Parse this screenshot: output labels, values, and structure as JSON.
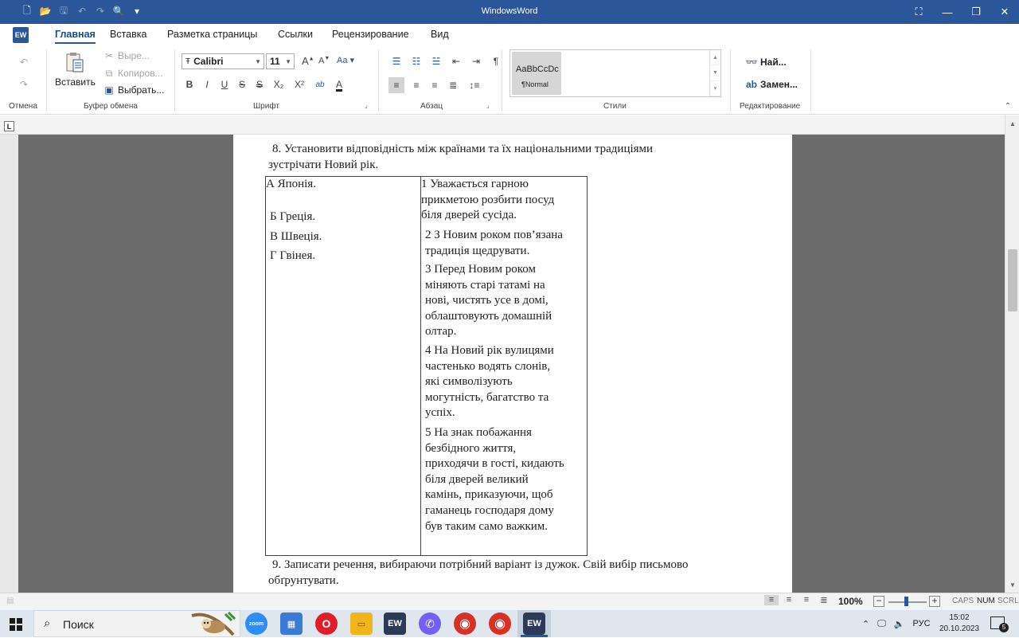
{
  "window": {
    "title": "WindowsWord",
    "qat": [
      {
        "name": "new-document-icon",
        "glyph": "🗋",
        "disabled": false
      },
      {
        "name": "open-folder-icon",
        "glyph": "📂",
        "disabled": false
      },
      {
        "name": "save-icon",
        "glyph": "🖫",
        "disabled": true
      },
      {
        "name": "undo-icon",
        "glyph": "↶",
        "disabled": true
      },
      {
        "name": "redo-icon",
        "glyph": "↷",
        "disabled": true
      },
      {
        "name": "print-preview-icon",
        "glyph": "🔍",
        "disabled": false
      },
      {
        "name": "customize-qat-icon",
        "glyph": "▾",
        "disabled": false
      }
    ],
    "controls": [
      {
        "name": "fullscreen-icon",
        "glyph": "⛶"
      },
      {
        "name": "minimize-icon",
        "glyph": "—"
      },
      {
        "name": "restore-icon",
        "glyph": "❐"
      },
      {
        "name": "close-icon",
        "glyph": "✕"
      }
    ]
  },
  "file_button": {
    "label": "EW"
  },
  "tabs": [
    "Главная",
    "Вставка",
    "Разметка страницы",
    "Ссылки",
    "Рецензирование",
    "Вид"
  ],
  "ribbon": {
    "undo": {
      "group": "Отмена",
      "undo_glyph": "↶",
      "redo_glyph": "↷"
    },
    "clipboard": {
      "group": "Буфер обмена",
      "paste": "Вставить",
      "cut": "Выре...",
      "copy": "Копиров...",
      "select": "Выбрать..."
    },
    "font": {
      "group": "Шрифт",
      "font_name": "Calibri",
      "font_size": "11",
      "format_buttons": [
        {
          "name": "bold-button",
          "glyph": "B"
        },
        {
          "name": "italic-button",
          "glyph": "I"
        },
        {
          "name": "underline-button",
          "glyph": "U"
        },
        {
          "name": "strikethrough-button",
          "glyph": "S"
        },
        {
          "name": "double-strikethrough-button",
          "glyph": "S"
        },
        {
          "name": "subscript-button",
          "glyph": "X₂"
        },
        {
          "name": "superscript-button",
          "glyph": "X²"
        },
        {
          "name": "highlight-button",
          "glyph": "ab"
        },
        {
          "name": "font-color-button",
          "glyph": "A"
        }
      ]
    },
    "paragraph": {
      "group": "Абзац"
    },
    "styles": {
      "group": "Стили",
      "sample": "AaBbCcDc",
      "name": "¶Normal"
    },
    "editing": {
      "group": "Редактирование",
      "find": "Най...",
      "replace": "Замен..."
    }
  },
  "document": {
    "q8_line1": "8. Установити відповідність між країнами та їх національними традиціями",
    "q8_line2": "зустрічати Новий рік.",
    "countries": [
      "А Японія.",
      "Б Греція.",
      "В Швеція.",
      "Г Гвінея."
    ],
    "traditions": [
      [
        "1 Уважається гарною",
        "прикметою розбити посуд",
        "біля дверей сусіда."
      ],
      [
        "2 З Новим роком пов’язана",
        "традиція щедрувати."
      ],
      [
        "3 Перед Новим роком",
        "міняють старі татамі на",
        "нові, чистять усе в домі,",
        "облаштовують домашній",
        "олтар."
      ],
      [
        "4 На Новий рік вулицями",
        "частенько водять слонів,",
        "які символізують",
        "могутність, багатство та",
        "успіх."
      ],
      [
        "5 На знак побажання",
        "безбідного життя,",
        "приходячи в гості, кидають",
        "біля дверей великий",
        "камінь, приказуючи, щоб",
        "гаманець господаря дому",
        "був таким само важким."
      ]
    ],
    "q9_line1": "9. Записати речення, вибираючи потрібний варіант із дужок. Свій вибір письмово",
    "q9_line2": "обґрунтувати."
  },
  "status": {
    "zoom": "100%",
    "caps": "CAPS",
    "num": "NUM",
    "scrl": "SCRL"
  },
  "taskbar": {
    "search_placeholder": "Поиск",
    "apps": [
      {
        "name": "zoom-app-icon",
        "label": "zoom",
        "color": "#2d8cff"
      },
      {
        "name": "store-app-icon",
        "label": "▦",
        "color": "#3a7bd5"
      },
      {
        "name": "opera-app-icon",
        "label": "O",
        "color": "#e01e2b"
      },
      {
        "name": "file-explorer-icon",
        "label": "▭",
        "color": "#f1b51c"
      },
      {
        "name": "windowsword-app-icon",
        "label": "EW",
        "color": "#2b3a57"
      },
      {
        "name": "viber-app-icon",
        "label": "✆",
        "color": "#7360f2"
      },
      {
        "name": "chrome-app-icon",
        "label": "◉",
        "color": "#d93025"
      },
      {
        "name": "chrome-profile-app-icon",
        "label": "◉",
        "color": "#d93025"
      },
      {
        "name": "windowsword-active-app-icon",
        "label": "EW",
        "color": "#2b3a57"
      }
    ],
    "lang": "РУС",
    "time": "15:02",
    "date": "20.10.2023",
    "notifications": "5"
  }
}
